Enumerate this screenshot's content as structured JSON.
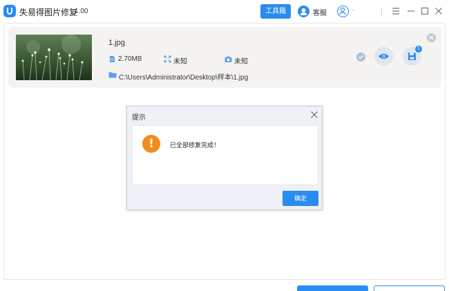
{
  "app": {
    "title": "失易得图片修复",
    "version": "1.00"
  },
  "header": {
    "toolbox_label": "工具箱",
    "service_label": "客服",
    "user_name": "-"
  },
  "file": {
    "name": "1.jpg",
    "size": "2.70MB",
    "resolution": "未知",
    "camera": "未知",
    "path": "C:\\Users\\Administrator\\Desktop\\样本\\1.jpg",
    "save_badge": "1"
  },
  "dialog": {
    "title": "提示",
    "message": "已全部修复完成！",
    "ok_label": "确定"
  },
  "colors": {
    "accent": "#2a8cf0",
    "warning": "#f28c1a",
    "card_bg": "#f5f3f1",
    "dialog_bg": "#eef1f6"
  },
  "icons": {
    "logo": "app-logo-icon",
    "service": "headset-avatar-icon",
    "user": "user-avatar-icon",
    "menu": "menu-icon",
    "minimize": "minimize-icon",
    "maximize": "maximize-icon",
    "close": "close-icon",
    "size": "file-size-icon",
    "resolution": "resolution-icon",
    "camera": "camera-icon",
    "folder": "folder-icon",
    "status": "check-icon",
    "preview": "eye-icon",
    "save": "save-icon",
    "warning": "warning-icon"
  }
}
